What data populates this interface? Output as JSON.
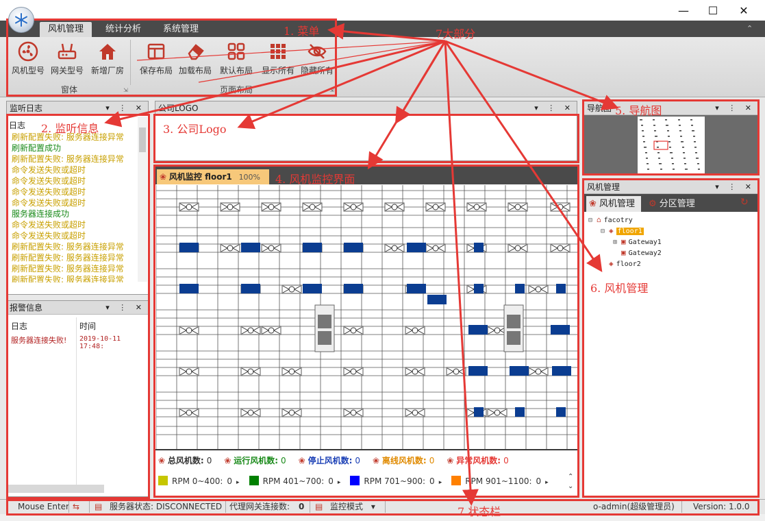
{
  "app": {
    "ribbon_tabs": [
      "风机管理",
      "统计分析",
      "系统管理"
    ]
  },
  "ribbon": {
    "group1": {
      "label": "窗体",
      "buttons": [
        "风机型号",
        "网关型号",
        "新增厂房"
      ]
    },
    "group2": {
      "label": "页面布局",
      "buttons": [
        "保存布局",
        "加载布局",
        "默认布局",
        "显示所有",
        "隐藏所有"
      ]
    }
  },
  "monitor_log": {
    "title": "监听日志",
    "header": "日志",
    "lines": [
      {
        "text": "刷新配置失败: 服务器连接异常",
        "color": "#c8a000"
      },
      {
        "text": "刷新配置成功",
        "color": "#1a8a1a"
      },
      {
        "text": "刷新配置失败: 服务器连接异常",
        "color": "#c8a000"
      },
      {
        "text": "命令发送失败或超时",
        "color": "#c8a000"
      },
      {
        "text": "命令发送失败或超时",
        "color": "#c8a000"
      },
      {
        "text": "命令发送失败或超时",
        "color": "#c8a000"
      },
      {
        "text": "命令发送失败或超时",
        "color": "#c8a000"
      },
      {
        "text": "服务器连接成功",
        "color": "#1a8a1a"
      },
      {
        "text": "命令发送失败或超时",
        "color": "#c8a000"
      },
      {
        "text": "命令发送失败或超时",
        "color": "#c8a000"
      },
      {
        "text": "刷新配置失败: 服务器连接异常",
        "color": "#c8a000"
      },
      {
        "text": "刷新配置失败: 服务器连接异常",
        "color": "#c8a000"
      },
      {
        "text": "刷新配置失败: 服务器连接异常",
        "color": "#c8a000"
      },
      {
        "text": "刷新配置失败: 服务器连接异常",
        "color": "#c8a000"
      }
    ]
  },
  "alarm": {
    "title": "报警信息",
    "col_log": "日志",
    "col_time": "时间",
    "rows": [
      {
        "log": "服务器连接失败!",
        "time": "2019-10-11 17:48:"
      }
    ]
  },
  "logo_pane": {
    "title": "公司LOGO"
  },
  "monitor": {
    "tab_label": "风机监控 floor1",
    "zoom": "100%",
    "stats": [
      {
        "label": "总风机数:",
        "value": "0",
        "color": "#333"
      },
      {
        "label": "运行风机数:",
        "value": "0",
        "color": "#1a8a1a"
      },
      {
        "label": "停止风机数:",
        "value": "0",
        "color": "#1a3fb5"
      },
      {
        "label": "离线风机数:",
        "value": "0",
        "color": "#e08a00"
      },
      {
        "label": "异常风机数:",
        "value": "0",
        "color": "#e53935"
      }
    ],
    "legend": [
      {
        "label": "RPM 0~400:",
        "value": "0",
        "color": "#c6c600"
      },
      {
        "label": "RPM 401~700:",
        "value": "0",
        "color": "#008000"
      },
      {
        "label": "RPM 701~900:",
        "value": "0",
        "color": "#0000ff"
      },
      {
        "label": "RPM 901~1100:",
        "value": "0",
        "color": "#ff8000"
      }
    ]
  },
  "nav_pane": {
    "title": "导航图"
  },
  "fan_mgmt": {
    "title": "风机管理",
    "tabs": [
      "风机管理",
      "分区管理"
    ],
    "tree": [
      {
        "label": "facotry",
        "level": 0,
        "expander": "⊟",
        "icon": "house"
      },
      {
        "label": "floor1",
        "level": 1,
        "expander": "⊟",
        "icon": "layers",
        "selected": true
      },
      {
        "label": "Gateway1",
        "level": 2,
        "expander": "⊞",
        "icon": "gateway"
      },
      {
        "label": "Gateway2",
        "level": 2,
        "expander": "",
        "icon": "gateway"
      },
      {
        "label": "floor2",
        "level": 1,
        "expander": "",
        "icon": "layers"
      }
    ]
  },
  "statusbar": {
    "mouse": "Mouse Enter",
    "server_status": "服务器状态: DISCONNECTED",
    "gateway_count_label": "代理网关连接数:",
    "gateway_count": "0",
    "mode": "监控模式",
    "user": "o-admin(超级管理员)",
    "version": "Version: 1.0.0"
  },
  "annotations": {
    "menu": "1. 菜单",
    "monitor_info": "2. 监听信息",
    "logo": "3. 公司Logo",
    "fan_monitor": "4. 风机监控界面",
    "nav": "5.  导航图",
    "fan_mgmt": "6.  风机管理",
    "statusbar": "7.状态栏",
    "seven_parts": "7大部分"
  }
}
